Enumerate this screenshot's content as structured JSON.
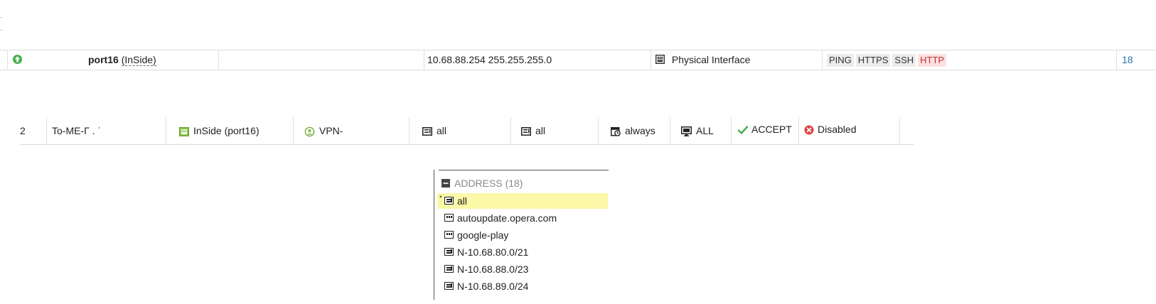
{
  "interface_row": {
    "status_icon": "arrow-up-circle-icon",
    "status_color": "#4caf50",
    "port_name": "port16",
    "port_alias": "(InSide)",
    "ip_netmask": "10.68.88.254 255.255.255.0",
    "type_icon": "physical-interface-icon",
    "type": "Physical Interface",
    "access": [
      "PING",
      "HTTPS",
      "SSH",
      "HTTP"
    ],
    "ref_count": "18"
  },
  "policy_row": {
    "id": "2",
    "name": "To-ME-Г .  ˈ",
    "incoming_interface": "InSide (port16)",
    "outgoing_interface": "VPN-",
    "source": "all",
    "destination": "all",
    "schedule": "always",
    "service": "ALL",
    "action": "ACCEPT",
    "nat": "Disabled",
    "accept_color": "#4caf50",
    "disabled_color": "#e04040"
  },
  "dropdown": {
    "header_label": "ADDRESS (18)",
    "items": [
      {
        "label": "all",
        "selected_mark": "*"
      },
      {
        "label": "autoupdate.opera.com"
      },
      {
        "label": "google-play"
      },
      {
        "label": "N-10.68.80.0/21"
      },
      {
        "label": "N-10.68.88.0/23"
      },
      {
        "label": "N-10.68.89.0/24"
      }
    ]
  }
}
